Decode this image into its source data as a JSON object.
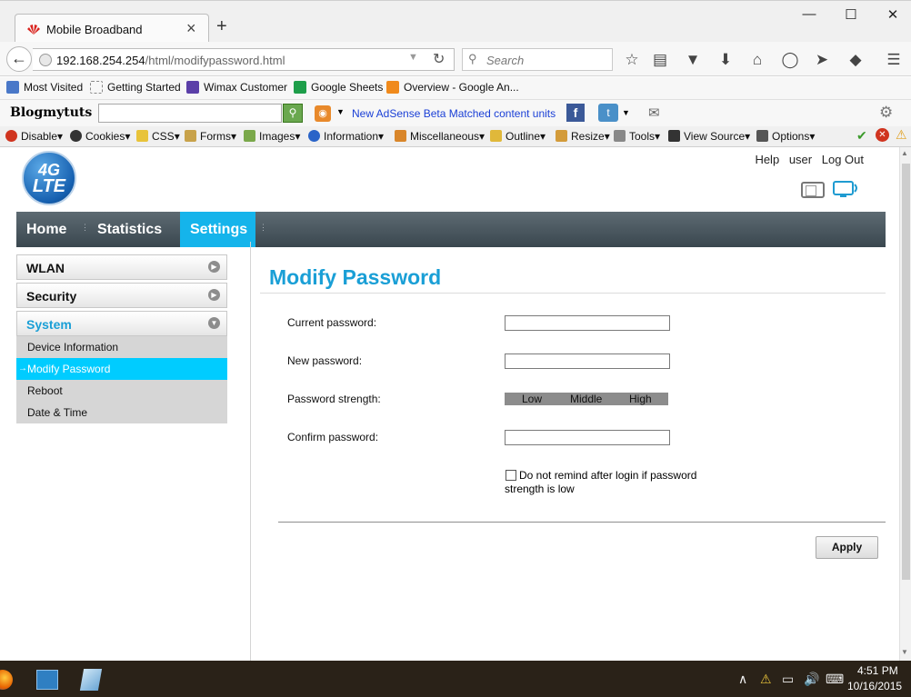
{
  "browser": {
    "tab_title": "Mobile Broadband",
    "new_tab": "+",
    "url_host": "192.168.254.254",
    "url_path": "/html/modifypassword.html",
    "search_placeholder": "Search",
    "bookmarks": [
      "Most Visited",
      "Getting Started",
      "Wimax Customer",
      "Google Sheets",
      "Overview - Google An..."
    ],
    "blog_brand": "Blogmytuts",
    "adsense_link": "New AdSense Beta Matched content units",
    "devbar": [
      "Disable",
      "Cookies",
      "CSS",
      "Forms",
      "Images",
      "Information",
      "Miscellaneous",
      "Outline",
      "Resize",
      "Tools",
      "View Source",
      "Options"
    ]
  },
  "header": {
    "logo_4g": "4G",
    "logo_lte": "LTE",
    "links": [
      "Help",
      "user",
      "Log Out"
    ]
  },
  "nav": {
    "items": [
      "Home",
      "Statistics",
      "Settings"
    ]
  },
  "sidebar": {
    "sections": [
      "WLAN",
      "Security",
      "System"
    ],
    "system_items": [
      "Device Information",
      "Modify Password",
      "Reboot",
      "Date & Time"
    ]
  },
  "form": {
    "title": "Modify Password",
    "current_label": "Current password:",
    "new_label": "New password:",
    "strength_label": "Password strength:",
    "strength_levels": [
      "Low",
      "Middle",
      "High"
    ],
    "confirm_label": "Confirm password:",
    "remind_label": "Do not remind after login if password strength is low",
    "apply": "Apply"
  },
  "taskbar": {
    "time": "4:51 PM",
    "date": "10/16/2015"
  },
  "colors": {
    "accent": "#15b4eb",
    "title": "#1a9fd6",
    "nav_bg": "#3a474f",
    "active_sub": "#00ccff"
  }
}
